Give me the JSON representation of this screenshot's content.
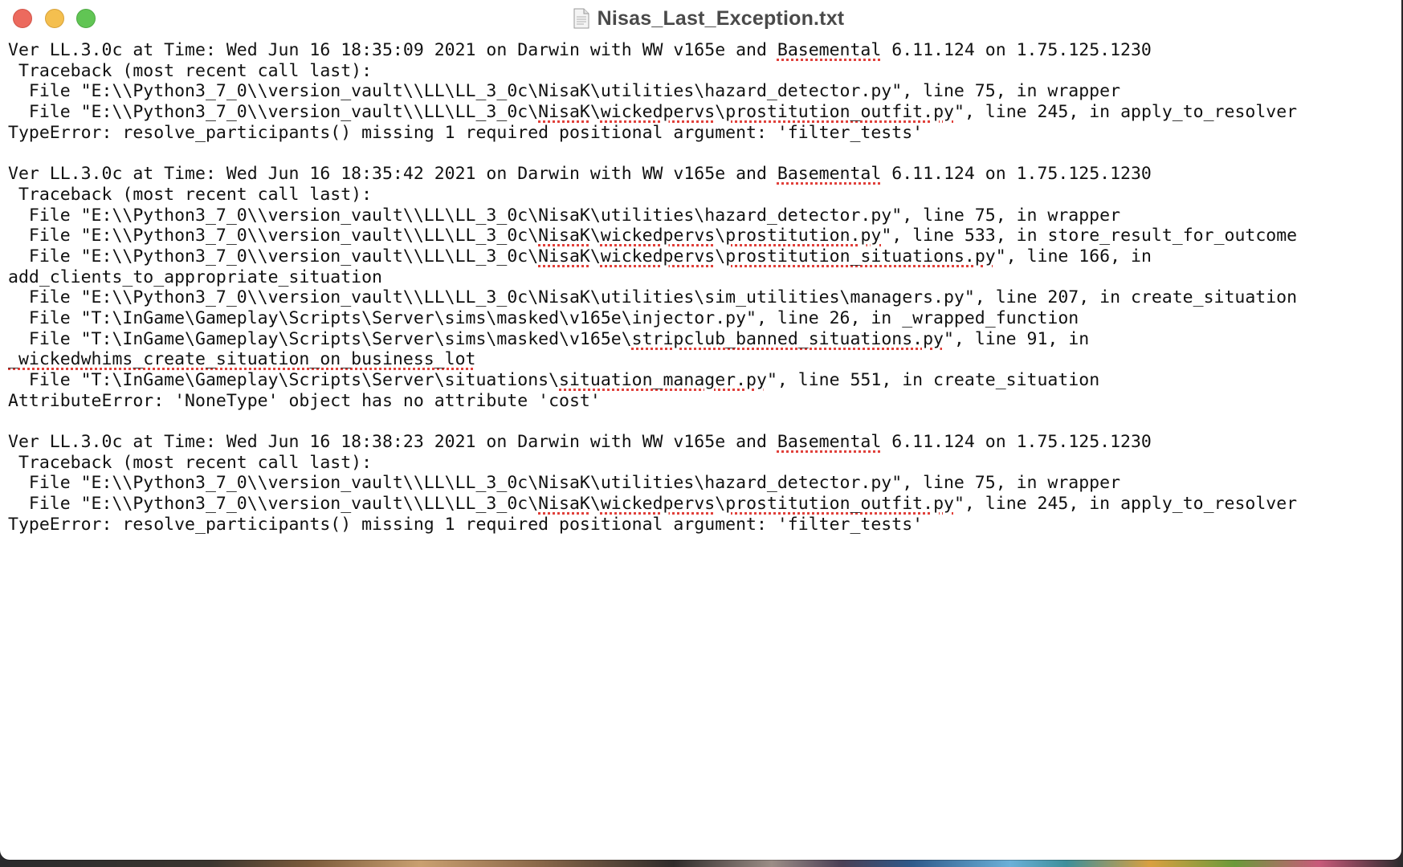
{
  "window": {
    "title": "Nisas_Last_Exception.txt"
  },
  "document": {
    "lines": [
      [
        {
          "t": "Ver LL.3.0c at Time: Wed Jun 16 18:35:09 2021 on Darwin with WW v165e and "
        },
        {
          "t": "Basemental",
          "s": true
        },
        {
          "t": " 6.11.124 on 1.75.125.1230"
        }
      ],
      [
        {
          "t": " Traceback (most recent call last):"
        }
      ],
      [
        {
          "t": "  File \"E:\\\\Python3_7_0\\\\version_vault\\\\LL\\LL_3_0c\\NisaK\\utilities\\hazard_detector.py\", line 75, in wrapper"
        }
      ],
      [
        {
          "t": "  File \"E:\\\\Python3_7_0\\\\version_vault\\\\LL\\LL_3_0c\\"
        },
        {
          "t": "NisaK",
          "s": true
        },
        {
          "t": "\\"
        },
        {
          "t": "wickedpervs",
          "s": true
        },
        {
          "t": "\\"
        },
        {
          "t": "prostitution_outfit.py",
          "s": true
        },
        {
          "t": "\", line 245, in apply_to_resolver"
        }
      ],
      [
        {
          "t": "TypeError: resolve_participants() missing 1 required positional argument: 'filter_tests'"
        }
      ],
      [
        {
          "t": ""
        }
      ],
      [
        {
          "t": "Ver LL.3.0c at Time: Wed Jun 16 18:35:42 2021 on Darwin with WW v165e and "
        },
        {
          "t": "Basemental",
          "s": true
        },
        {
          "t": " 6.11.124 on 1.75.125.1230"
        }
      ],
      [
        {
          "t": " Traceback (most recent call last):"
        }
      ],
      [
        {
          "t": "  File \"E:\\\\Python3_7_0\\\\version_vault\\\\LL\\LL_3_0c\\NisaK\\utilities\\hazard_detector.py\", line 75, in wrapper"
        }
      ],
      [
        {
          "t": "  File \"E:\\\\Python3_7_0\\\\version_vault\\\\LL\\LL_3_0c\\"
        },
        {
          "t": "NisaK",
          "s": true
        },
        {
          "t": "\\"
        },
        {
          "t": "wickedpervs",
          "s": true
        },
        {
          "t": "\\"
        },
        {
          "t": "prostitution.py",
          "s": true
        },
        {
          "t": "\", line 533, in store_result_for_outcome"
        }
      ],
      [
        {
          "t": "  File \"E:\\\\Python3_7_0\\\\version_vault\\\\LL\\LL_3_0c\\"
        },
        {
          "t": "NisaK",
          "s": true
        },
        {
          "t": "\\"
        },
        {
          "t": "wickedpervs",
          "s": true
        },
        {
          "t": "\\"
        },
        {
          "t": "prostitution_situations.py",
          "s": true
        },
        {
          "t": "\", line 166, in"
        }
      ],
      [
        {
          "t": "add_clients_to_appropriate_situation"
        }
      ],
      [
        {
          "t": "  File \"E:\\\\Python3_7_0\\\\version_vault\\\\LL\\LL_3_0c\\NisaK\\utilities\\sim_utilities\\managers.py\", line 207, in create_situation"
        }
      ],
      [
        {
          "t": "  File \"T:\\InGame\\Gameplay\\Scripts\\Server\\sims\\masked\\v165e\\injector.py\", line 26, in _wrapped_function"
        }
      ],
      [
        {
          "t": "  File \"T:\\InGame\\Gameplay\\Scripts\\Server\\sims\\masked\\v165e\\"
        },
        {
          "t": "stripclub_banned_situations.py",
          "s": true
        },
        {
          "t": "\", line 91, in"
        }
      ],
      [
        {
          "t": "_wickedwhims_create_situation_on_business_lot",
          "s": true
        }
      ],
      [
        {
          "t": "  File \"T:\\InGame\\Gameplay\\Scripts\\Server\\situations\\"
        },
        {
          "t": "situation_manager.py",
          "s": true
        },
        {
          "t": "\", line 551, in create_situation"
        }
      ],
      [
        {
          "t": "AttributeError: 'NoneType' object has no attribute 'cost'"
        }
      ],
      [
        {
          "t": ""
        }
      ],
      [
        {
          "t": "Ver LL.3.0c at Time: Wed Jun 16 18:38:23 2021 on Darwin with WW v165e and "
        },
        {
          "t": "Basemental",
          "s": true
        },
        {
          "t": " 6.11.124 on 1.75.125.1230"
        }
      ],
      [
        {
          "t": " Traceback (most recent call last):"
        }
      ],
      [
        {
          "t": "  File \"E:\\\\Python3_7_0\\\\version_vault\\\\LL\\LL_3_0c\\NisaK\\utilities\\hazard_detector.py\", line 75, in wrapper"
        }
      ],
      [
        {
          "t": "  File \"E:\\\\Python3_7_0\\\\version_vault\\\\LL\\LL_3_0c\\"
        },
        {
          "t": "NisaK",
          "s": true
        },
        {
          "t": "\\"
        },
        {
          "t": "wickedpervs",
          "s": true
        },
        {
          "t": "\\"
        },
        {
          "t": "prostitution_outfit.py",
          "s": true
        },
        {
          "t": "\", line 245, in apply_to_resolver"
        }
      ],
      [
        {
          "t": "TypeError: resolve_participants() missing 1 required positional argument: 'filter_tests'"
        }
      ]
    ]
  },
  "colors": {
    "spellcheck_underline": "#e0403a",
    "close": "#ec6a5e",
    "minimize": "#f4bf4f",
    "maximize": "#61c554"
  },
  "icons": {
    "close": "close-button",
    "minimize": "minimize-button",
    "maximize": "zoom-button",
    "document": "text-document-icon"
  }
}
